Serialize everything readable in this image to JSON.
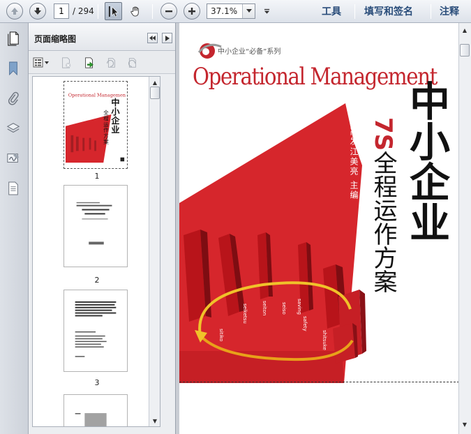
{
  "toolbar": {
    "page_current": "1",
    "page_total": "/ 294",
    "zoom": "37.1%",
    "tools_label": "工具",
    "fill_sign_label": "填写和签名",
    "comment_label": "注释"
  },
  "sidebar": {
    "title": "页面缩略图",
    "thumbnails": [
      {
        "num": "1"
      },
      {
        "num": "2"
      },
      {
        "num": "3"
      }
    ]
  },
  "cover": {
    "series": "中小企业“必备”系列",
    "title_en": "Operational Management",
    "title_main": "中小企业",
    "subtitle_7s": "7S",
    "subtitle": "全程运作方案",
    "author_1": "涂高发",
    "author_2": "江美亮 主编",
    "bar_labels": [
      "sitiko",
      "seiketsu",
      "seiton",
      "seiso",
      "safety",
      "shitsuke",
      "saving"
    ]
  },
  "colors": {
    "cover_red": "#c4262e",
    "accent_blue": "#2a4d7a"
  }
}
